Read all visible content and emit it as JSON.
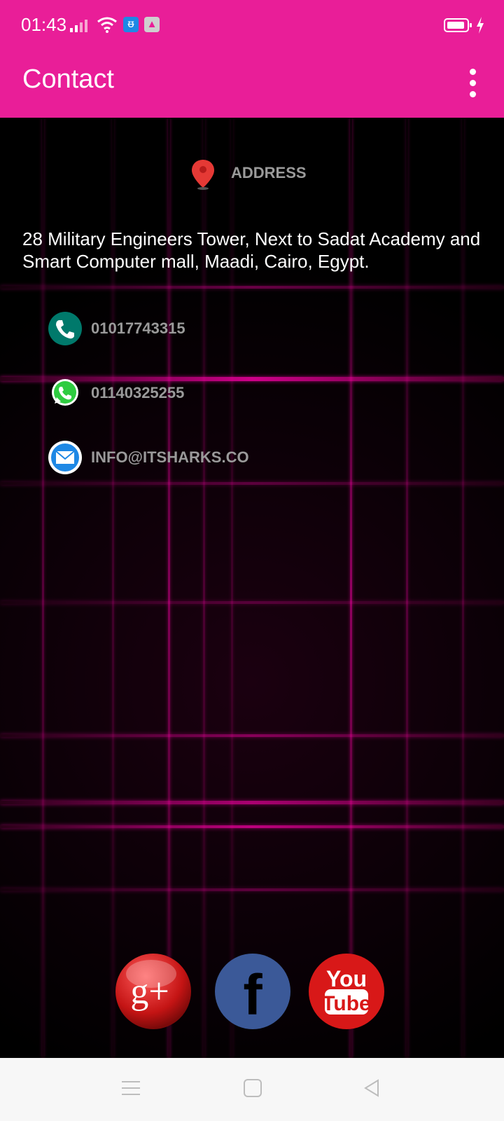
{
  "status_bar": {
    "time": "01:43",
    "icons": [
      "signal-icon",
      "wifi-icon",
      "usb-icon",
      "data-transfer-icon",
      "battery-icon",
      "charging-icon"
    ]
  },
  "app_bar": {
    "title": "Contact",
    "menu_icon": "more-vert-icon"
  },
  "address": {
    "label": "ADDRESS",
    "icon": "map-pin-icon",
    "text": "28 Military Engineers Tower, Next to Sadat Academy and Smart Computer mall, Maadi, Cairo, Egypt."
  },
  "contacts": [
    {
      "icon": "phone-icon",
      "value": "01017743315"
    },
    {
      "icon": "whatsapp-icon",
      "value": "01140325255"
    },
    {
      "icon": "email-icon",
      "value": "INFO@ITSHARKS.CO"
    }
  ],
  "social": [
    {
      "icon": "google-plus-icon",
      "label": "g+"
    },
    {
      "icon": "facebook-icon",
      "label": "f"
    },
    {
      "icon": "youtube-icon",
      "label_top": "You",
      "label_bottom": "Tube"
    }
  ],
  "nav_bar": {
    "icons": [
      "menu-icon",
      "home-icon",
      "back-icon"
    ]
  },
  "colors": {
    "accent": "#e91e98",
    "background": "#000000",
    "muted_text": "#9a9a9a"
  }
}
